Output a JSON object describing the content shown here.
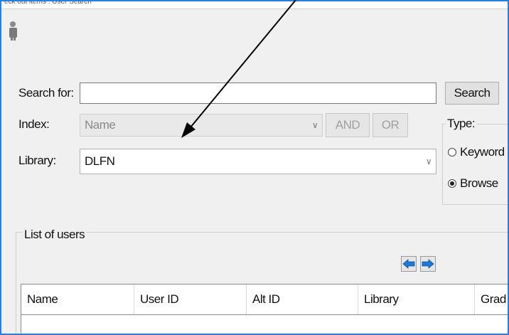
{
  "window": {
    "title": "eck out items : User Search"
  },
  "search": {
    "label": "Search for:",
    "value": "",
    "button": "Search"
  },
  "index": {
    "label": "Index:",
    "value": "Name",
    "and_button": "AND",
    "or_button": "OR"
  },
  "library": {
    "label": "Library:",
    "value": "DLFN"
  },
  "type": {
    "label": "Type:",
    "options": [
      {
        "label": "Keyword",
        "checked": false
      },
      {
        "label": "Browse",
        "checked": true
      }
    ]
  },
  "users": {
    "legend": "List of users",
    "columns": [
      "Name",
      "User ID",
      "Alt ID",
      "Library",
      "Grad"
    ]
  },
  "colors": {
    "frame_border": "#2a7de1",
    "background": "#f0f0f0",
    "nav_arrow": "#1e78d7"
  }
}
